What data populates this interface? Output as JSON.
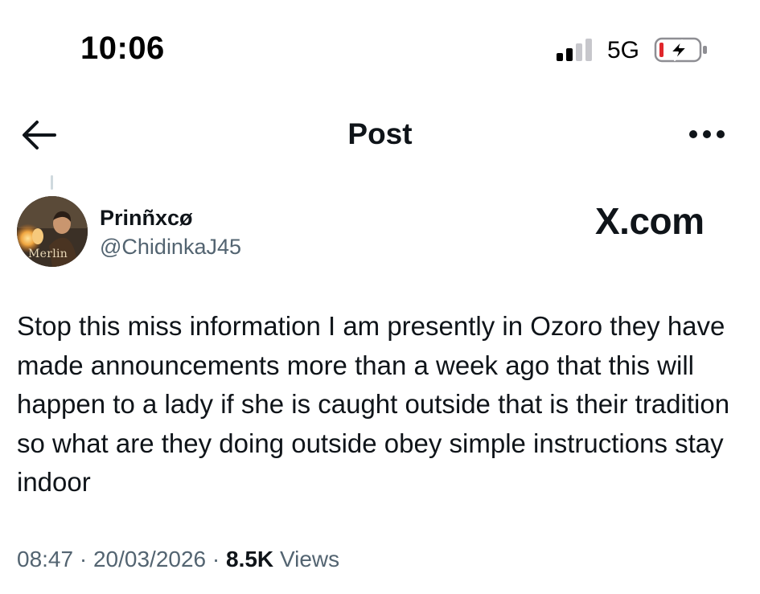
{
  "status_bar": {
    "time": "10:06",
    "network": "5G",
    "signal_icon": "cellular-signal-icon",
    "battery_icon": "battery-charging-icon",
    "battery_low_color": "#e0262b"
  },
  "header": {
    "title": "Post",
    "back_icon": "arrow-left-icon",
    "more_icon": "more-horizontal-icon"
  },
  "post": {
    "author": {
      "display_name": "Prinñxcø",
      "handle": "@ChidinkaJ45",
      "avatar_caption": "Merlin"
    },
    "watermark": "X.com",
    "text": "Stop this miss information I am presently in Ozoro they have made announcements more than a week ago that this will happen to a lady if she is caught outside that is their tradition so what are they doing outside obey simple instructions stay indoor",
    "meta": {
      "time": "08:47",
      "separator": " · ",
      "date": "20/03/2026",
      "views_count": "8.5K",
      "views_label": "Views"
    }
  },
  "colors": {
    "primary_text": "#0f1419",
    "secondary_text": "#536471",
    "thread_line": "#cfd9de"
  }
}
